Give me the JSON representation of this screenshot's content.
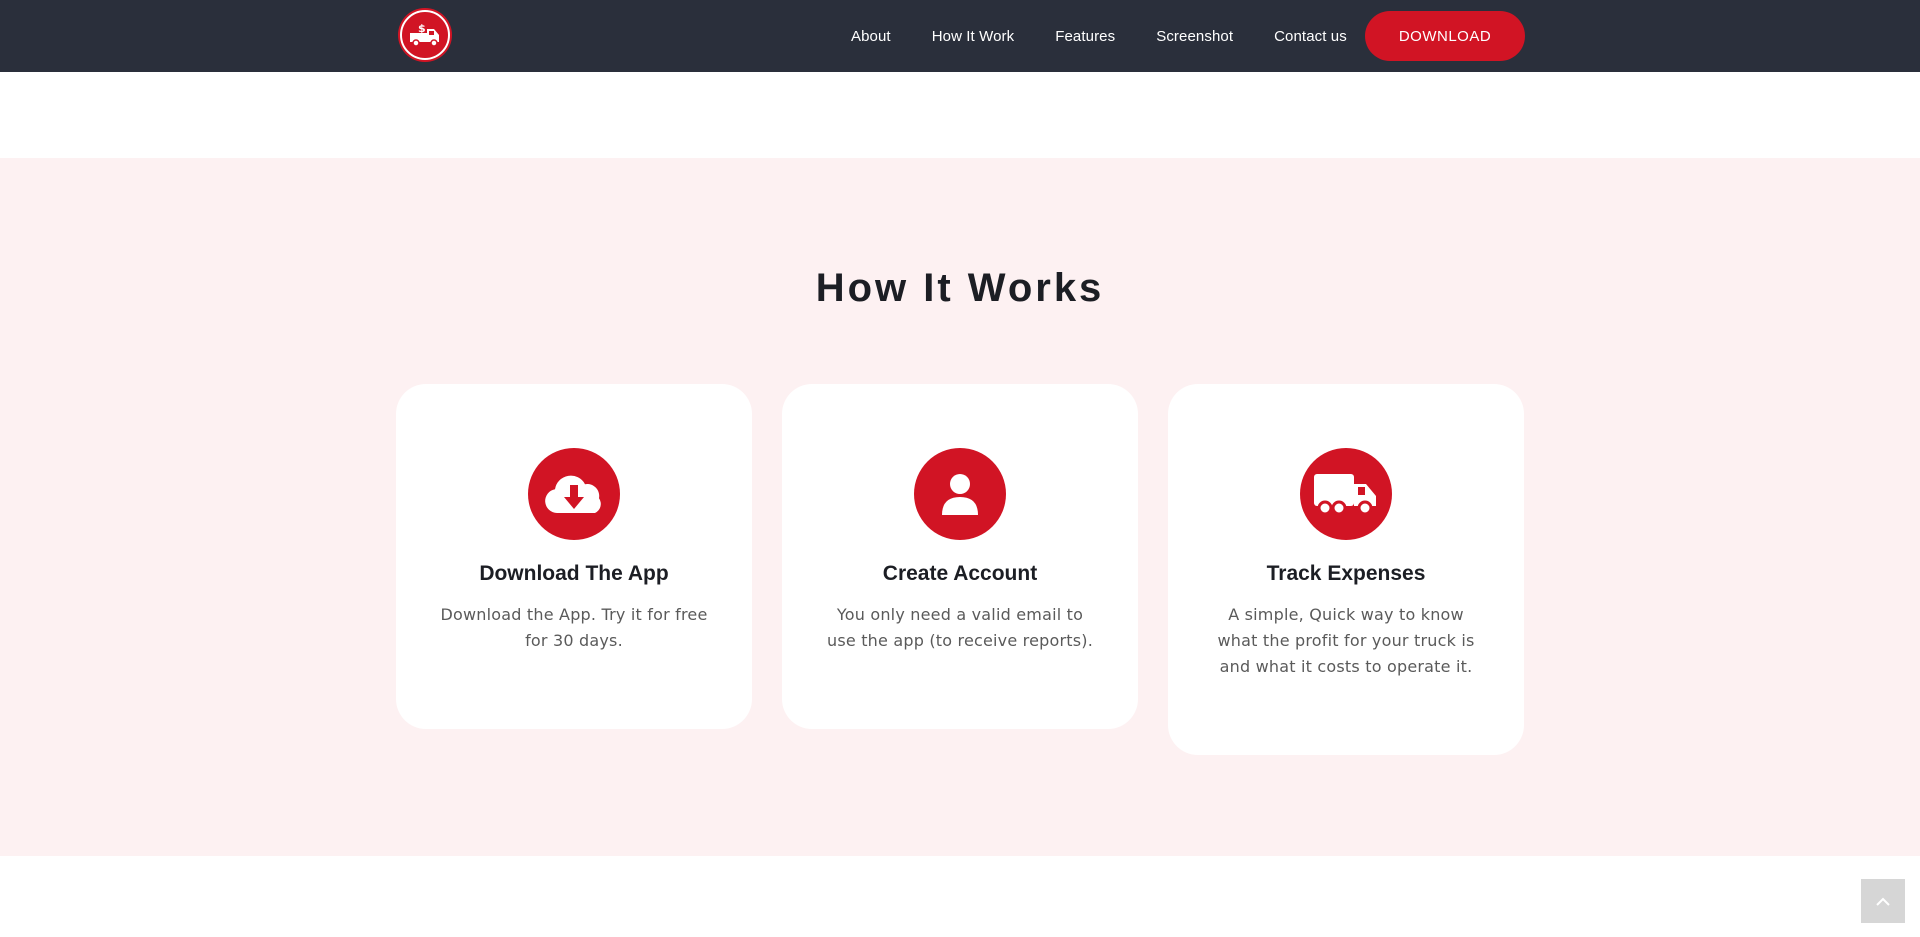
{
  "header": {
    "logo_icon": "truck-dollar-icon",
    "nav": [
      {
        "label": "About"
      },
      {
        "label": "How It Work"
      },
      {
        "label": "Features"
      },
      {
        "label": "Screenshot"
      },
      {
        "label": "Contact us"
      }
    ],
    "download_label": "DOWNLOAD"
  },
  "how_it_works": {
    "title": "How It Works",
    "cards": [
      {
        "icon": "cloud-download-icon",
        "title": "Download The App",
        "text": "Download the App. Try it for free for 30 days."
      },
      {
        "icon": "user-icon",
        "title": "Create Account",
        "text": "You only need a valid email to use the app (to receive reports)."
      },
      {
        "icon": "truck-icon",
        "title": "Track Expenses",
        "text": "A simple, Quick way to know what the profit for your truck is and what it costs to operate it."
      }
    ]
  },
  "scroll_top_icon": "chevron-up-icon",
  "colors": {
    "nav_bg": "#2a2f3b",
    "accent": "#d11424",
    "section_bg": "#fdf1f2"
  }
}
